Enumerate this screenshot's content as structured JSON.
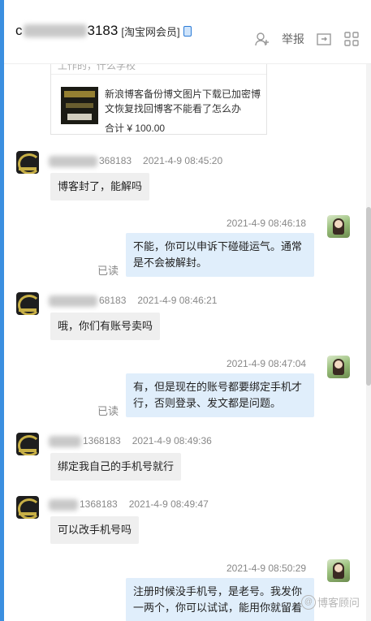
{
  "header": {
    "name_prefix": "c",
    "name_suffix": "3183",
    "tag": "[淘宝网会员]",
    "report_label": "举报"
  },
  "order": {
    "top_text": "工作的，什么学校",
    "title": "新浪博客备份博文图片下载已加密博文恢复找回博客不能看了怎么办",
    "price": "合计 ¥ 100.00"
  },
  "messages": [
    {
      "side": "left",
      "name": "368183",
      "time": "2021-4-9 08:45:20",
      "text": "博客封了，能解吗"
    },
    {
      "side": "right",
      "time": "2021-4-9 08:46:18",
      "lines": [
        "不能，你可以申诉下碰碰运气。通常",
        "是不会被解封。"
      ],
      "status": "已读"
    },
    {
      "side": "left",
      "name": "68183",
      "time": "2021-4-9 08:46:21",
      "text": "哦，你们有账号卖吗"
    },
    {
      "side": "right",
      "time": "2021-4-9 08:47:04",
      "lines": [
        "有，但是现在的账号都要绑定手机才",
        "行，否则登录、发文都是问题。"
      ],
      "status": "已读"
    },
    {
      "side": "left",
      "name": "1368183",
      "time": "2021-4-9 08:49:36",
      "text": "绑定我自己的手机号就行"
    },
    {
      "side": "left",
      "name": "1368183",
      "time": "2021-4-9 08:49:47",
      "text": "可以改手机号吗"
    },
    {
      "side": "right",
      "time": "2021-4-9 08:50:29",
      "lines": [
        "注册时候没手机号，是老号。我发你",
        "一两个，你可以试试，能用你就留着"
      ]
    }
  ],
  "watermark": "博客顾问",
  "colors": {
    "accent": "#3b8fe0",
    "bubble_left": "#efefef",
    "bubble_right": "#e0eefb"
  }
}
